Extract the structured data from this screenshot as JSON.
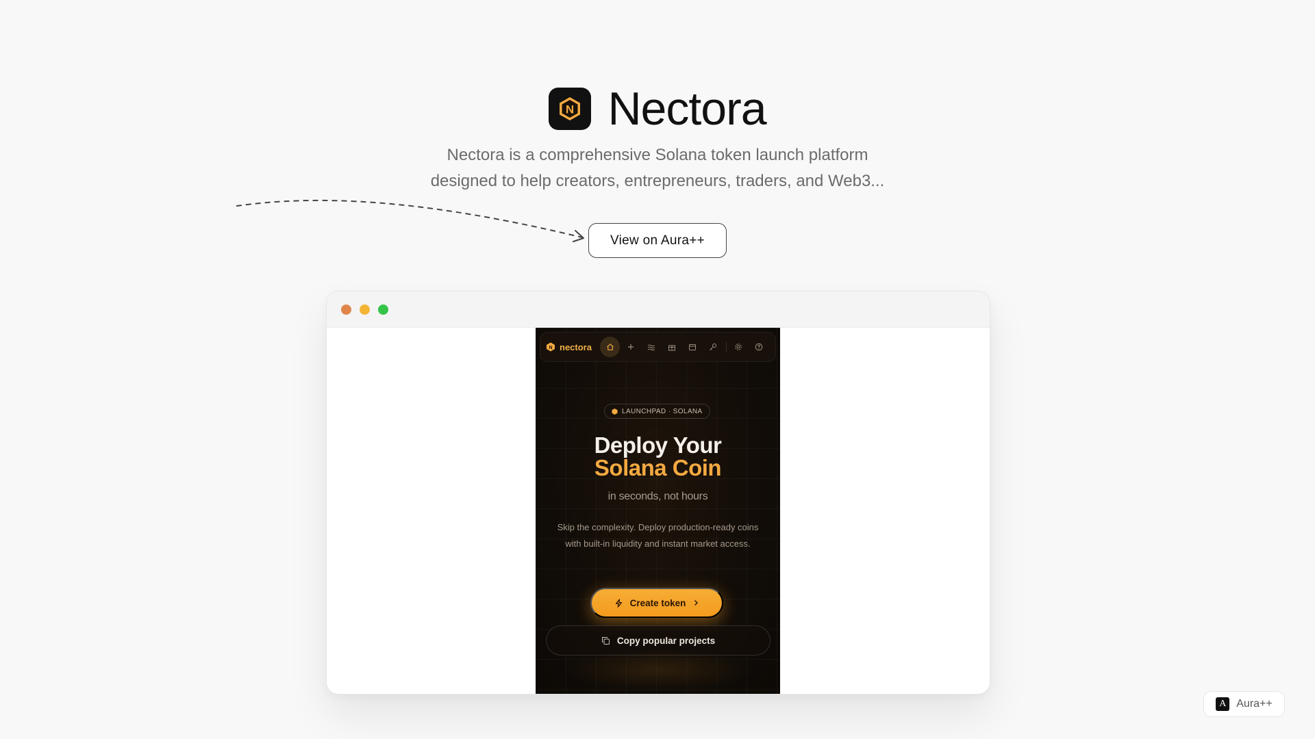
{
  "header": {
    "logo_letter": "N",
    "title": "Nectora",
    "description_line1": "Nectora is a comprehensive Solana token launch platform",
    "description_line2": "designed to help creators, entrepreneurs, traders, and Web3...",
    "view_button_label": "View on Aura++"
  },
  "colors": {
    "accent_orange": "#f4a941",
    "dark_bg": "#120d08",
    "traffic_red": "#e0844c",
    "traffic_yellow": "#f4b434",
    "traffic_green": "#34c44a"
  },
  "preview": {
    "nav": {
      "brand_name": "nectora",
      "icons": [
        "home-icon",
        "plus-icon",
        "waves-icon",
        "gift-icon",
        "calendar-icon",
        "key-icon",
        "gear-icon",
        "help-icon"
      ]
    },
    "badge_text": "LAUNCHPAD · SOLANA",
    "title_white": "Deploy Your",
    "title_orange": "Solana Coin",
    "subtitle": "in seconds, not hours",
    "description": "Skip the complexity. Deploy production-ready coins with built-in liquidity and instant market access.",
    "create_button_label": "Create token",
    "copy_button_label": "Copy popular projects"
  },
  "footer_badge": {
    "logo_letter": "A",
    "label": "Aura++"
  }
}
